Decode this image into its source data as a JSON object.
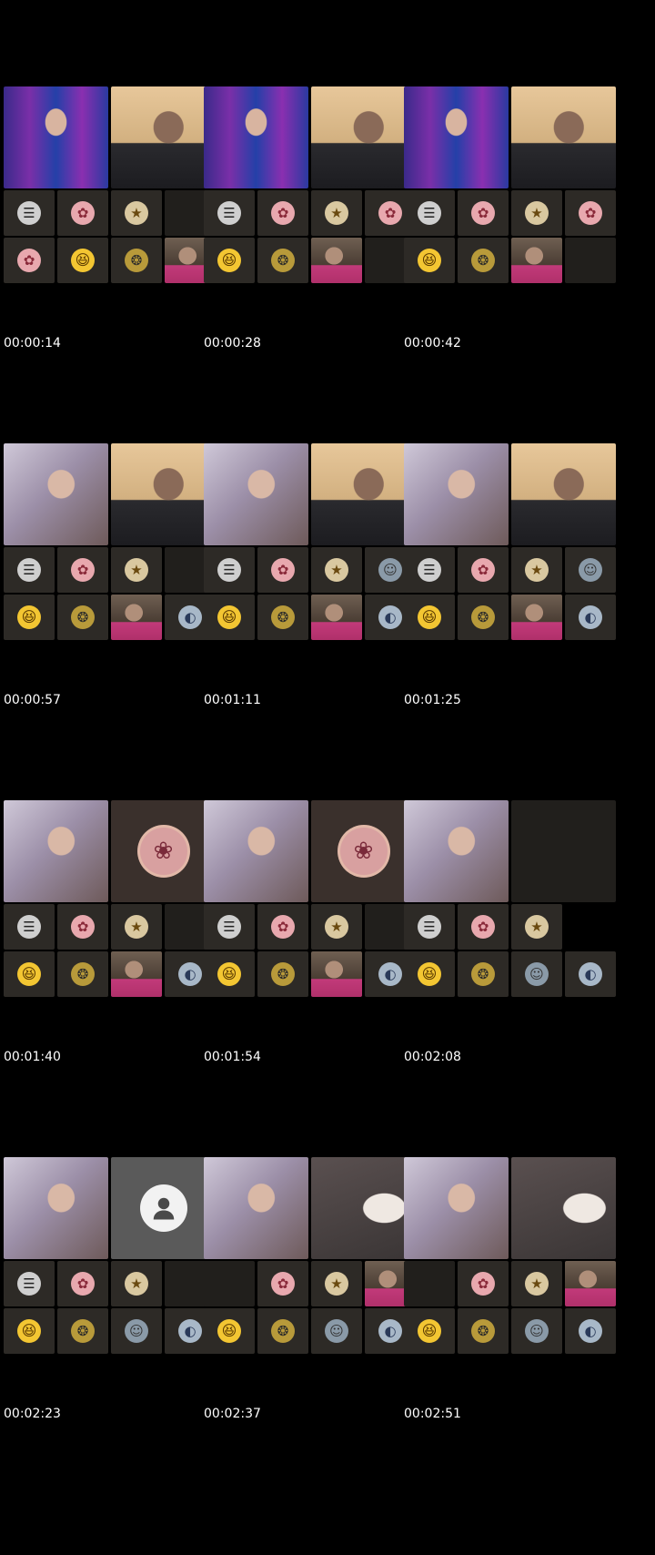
{
  "timestamps": [
    "00:00:14",
    "00:00:28",
    "00:00:42",
    "00:00:57",
    "00:01:11",
    "00:01:25",
    "00:01:40",
    "00:01:54",
    "00:02:08",
    "00:02:23",
    "00:02:37",
    "00:02:51"
  ],
  "icons": {
    "avatar_black": "☰",
    "avatar_pink": "✿",
    "avatar_gold": "★",
    "emoji": "😆",
    "wheel": "❂",
    "blue": "◐",
    "gray": "☺",
    "profile": "❀"
  }
}
